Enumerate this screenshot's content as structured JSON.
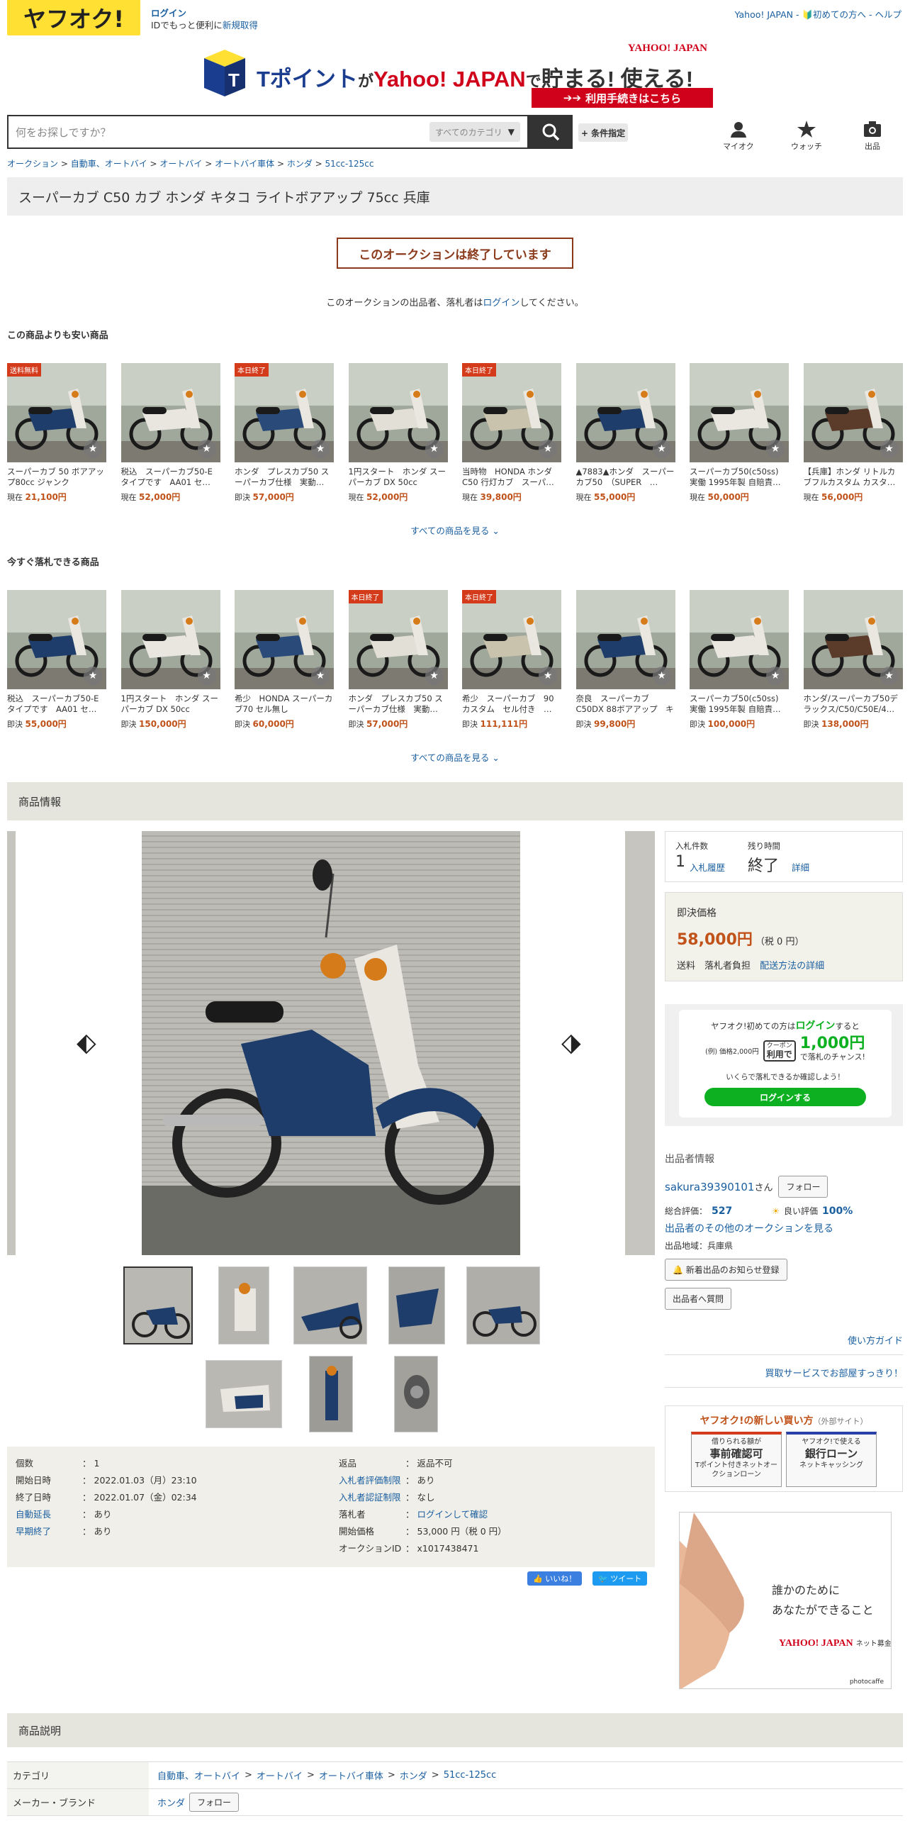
{
  "header": {
    "logo": "ヤフオク!",
    "login": "ログイン",
    "login_sub_prefix": "IDでもっと便利に",
    "signup": "新規取得",
    "top_links": "Yahoo! JAPAN - 🔰初めての方へ - ヘルプ"
  },
  "banner": {
    "brand": "YAHOO! JAPAN",
    "headline_a": "Tポイント",
    "headline_b": "が",
    "headline_c": "Yahoo! JAPAN",
    "headline_d": "で",
    "headline_e": "貯まる! 使える!",
    "cta": "利用手続きはこちら"
  },
  "search": {
    "placeholder": "何をお探しですか？",
    "category": "すべてのカテゴリ",
    "condition": "+ 条件指定"
  },
  "nav_icons": [
    {
      "label": "マイオク"
    },
    {
      "label": "ウォッチ"
    },
    {
      "label": "出品"
    }
  ],
  "breadcrumb": [
    "オークション",
    "自動車、オートバイ",
    "オートバイ",
    "オートバイ車体",
    "ホンダ",
    "51cc-125cc"
  ],
  "title": "スーパーカブ C50 カブ ホンダ キタコ ライトボアアップ 75cc 兵庫",
  "ended_label": "このオークションは終了しています",
  "ended_note_pre": "このオークションの出品者、落札者は",
  "ended_note_link": "ログイン",
  "ended_note_post": "してください。",
  "cheaper": {
    "heading": "この商品よりも安い商品",
    "more": "すべての商品を見る",
    "items": [
      {
        "name": "スーパーカブ 50 ボアアップ80cc ジャンク",
        "price_label": "現在",
        "price": "21,100円",
        "badge": "送料無料"
      },
      {
        "name": "税込　スーパーカブ50-E タイプです　AA01 セ…",
        "price_label": "現在",
        "price": "52,000円",
        "badge": ""
      },
      {
        "name": "ホンダ　プレスカブ50 スーパーカブ仕様　実動…",
        "price_label": "即決",
        "price": "57,000円",
        "badge": "本日終了"
      },
      {
        "name": "1円スタート　ホンダ スーパーカブ DX 50cc",
        "price_label": "現在",
        "price": "52,000円",
        "badge": ""
      },
      {
        "name": "当時物　HONDA ホンダ C50 行灯カブ　スーパ…",
        "price_label": "現在",
        "price": "39,800円",
        "badge": "本日終了"
      },
      {
        "name": "▲7883▲ホンダ　スーパーカブ50　（SUPER　…",
        "price_label": "現在",
        "price": "55,000円",
        "badge": ""
      },
      {
        "name": "スーパーカブ50(c50ss) 実働 1995年製 自賠責…",
        "price_label": "現在",
        "price": "50,000円",
        "badge": ""
      },
      {
        "name": "【兵庫】ホンダ リトルカブフルカスタム カスタ…",
        "price_label": "現在",
        "price": "56,000円",
        "badge": ""
      }
    ]
  },
  "buynow": {
    "heading": "今すぐ落札できる商品",
    "more": "すべての商品を見る",
    "items": [
      {
        "name": "税込　スーパーカブ50-E タイプです　AA01 セ…",
        "price_label": "即決",
        "price": "55,000円",
        "badge": ""
      },
      {
        "name": "1円スタート　ホンダ スーパーカブ DX 50cc",
        "price_label": "即決",
        "price": "150,000円",
        "badge": ""
      },
      {
        "name": "希少　HONDA スーパーカブ70 セル無し",
        "price_label": "即決",
        "price": "60,000円",
        "badge": ""
      },
      {
        "name": "ホンダ　プレスカブ50 スーパーカブ仕様　実動…",
        "price_label": "即決",
        "price": "57,000円",
        "badge": "本日終了"
      },
      {
        "name": "希少　スーパーカブ　90カスタム　セル付き　…",
        "price_label": "即決",
        "price": "111,111円",
        "badge": "本日終了"
      },
      {
        "name": "奈良　スーパーカブC50DX 88ボアアップ　キャ…",
        "price_label": "即決",
        "price": "99,800円",
        "badge": ""
      },
      {
        "name": "スーパーカブ50(c50ss) 実働 1995年製 自賠責…",
        "price_label": "即決",
        "price": "100,000円",
        "badge": ""
      },
      {
        "name": "ホンダ/スーパーカブ50デラックス/C50/C50E/4…",
        "price_label": "即決",
        "price": "138,000円",
        "badge": ""
      }
    ]
  },
  "product_info_heading": "商品情報",
  "specs_left": [
    {
      "k": "個数",
      "v": "1",
      "link": false
    },
    {
      "k": "開始日時",
      "v": "2022.01.03（月）23:10",
      "link": false
    },
    {
      "k": "終了日時",
      "v": "2022.01.07（金）02:34",
      "link": false
    },
    {
      "k": "自動延長",
      "v": "あり",
      "link": true
    },
    {
      "k": "早期終了",
      "v": "あり",
      "link": true
    }
  ],
  "specs_right": [
    {
      "k": "返品",
      "v": "返品不可",
      "link": false
    },
    {
      "k": "入札者評価制限",
      "v": "あり",
      "link": true
    },
    {
      "k": "入札者認証制限",
      "v": "なし",
      "link": true
    },
    {
      "k": "落札者",
      "v": "ログインして確認",
      "link": false,
      "vlink": true
    },
    {
      "k": "開始価格",
      "v": "53,000 円（税 0 円）",
      "link": false
    },
    {
      "k": "オークションID",
      "v": "x1017438471",
      "link": false
    }
  ],
  "social": {
    "like": "👍 いいね！",
    "tweet": "ツイート"
  },
  "bid": {
    "count_label": "入札件数",
    "count": "1",
    "history": "入札履歴",
    "remain_label": "残り時間",
    "remain": "終了",
    "detail": "詳細"
  },
  "price": {
    "label": "即決価格",
    "value": "58,000円",
    "tax": "（税 0 円）",
    "ship_label": "送料",
    "ship": "落札者負担",
    "ship_link": "配送方法の詳細"
  },
  "promo": {
    "line1_a": "ヤフオク!初めての方は",
    "line1_b": "ログイン",
    "line1_c": "すると",
    "ex": "(例) 価格2,000円",
    "coupon_a": "クーポン",
    "coupon_b": "利用で",
    "amount": "1,000円",
    "tail": "で落札のチャンス!",
    "q": "いくらで落札できるか確認しよう！",
    "btn": "ログインする"
  },
  "seller": {
    "heading": "出品者情報",
    "name": "sakura39390101",
    "san": "さん",
    "follow": "フォロー",
    "rating_label": "総合評価：",
    "rating": "527",
    "good_label": "良い評価",
    "good": "100%",
    "other": "出品者のその他のオークションを見る",
    "region": "出品地域：兵庫県",
    "notify": "🔔 新着出品のお知らせ登録",
    "ask": "出品者へ質問"
  },
  "guide": "使い方ガイド",
  "buyservice": "買取サービスでお部屋すっきり！",
  "newbuy": {
    "title": "ヤフオク!の新しい買い方",
    "ext": "（外部サイト）",
    "a_top": "借りられる額が",
    "a_main": "事前確認可",
    "a_sub": "Tポイント付きネットオークションローン",
    "b_top": "ヤフオク!で使える",
    "b_main": "銀行ローン",
    "b_sub": "ネットキャッシング"
  },
  "ad": {
    "line1": "誰かのために",
    "line2": "あなたができること",
    "brand": "YAHOO! JAPAN",
    "brand_sub": "ネット募金",
    "credit": "photocaffe"
  },
  "description_heading": "商品説明",
  "desc": {
    "category_label": "カテゴリ",
    "category": [
      "自動車、オートバイ",
      "オートバイ",
      "オートバイ車体",
      "ホンダ",
      "51cc-125cc"
    ],
    "maker_label": "メーカー・ブランド",
    "maker": "ホンダ",
    "follow": "フォロー"
  },
  "colors": {
    "accent": "#c0521a",
    "yellow": "#ffe033",
    "green": "#0cb020",
    "link": "#1a5fa0"
  }
}
